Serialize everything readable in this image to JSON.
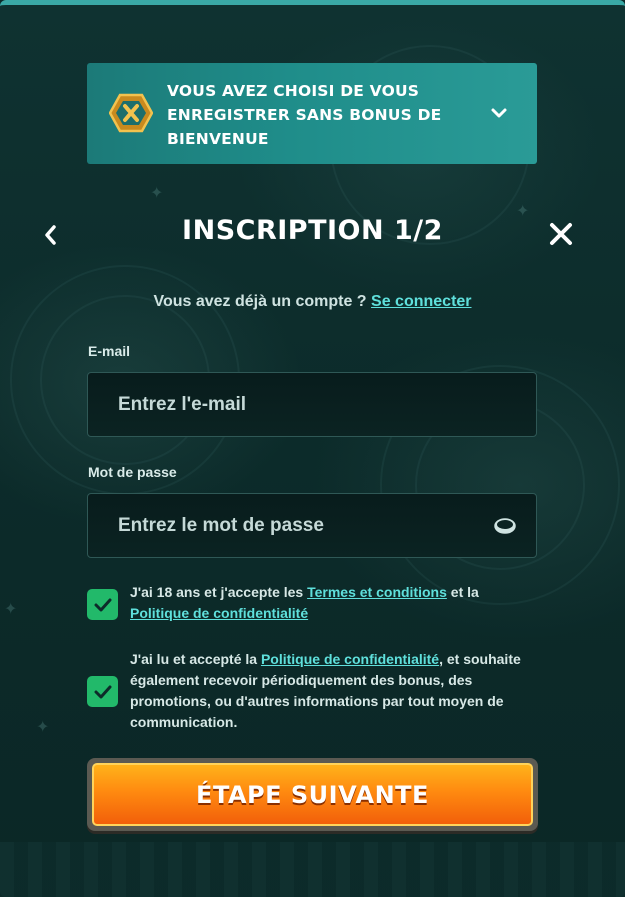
{
  "banner": {
    "text_line1": "VOUS AVEZ CHOISI DE VOUS",
    "text_line2": "ENREGISTRER SANS BONUS DE",
    "text_line3": "BIENVENUE"
  },
  "header": {
    "title": "INSCRIPTION 1/2"
  },
  "login": {
    "prompt": "Vous avez déjà un compte ?",
    "link": "Se connecter"
  },
  "email": {
    "label": "E-mail",
    "placeholder": "Entrez l'e-mail",
    "value": ""
  },
  "password": {
    "label": "Mot de passe",
    "placeholder": "Entrez le mot de passe",
    "value": ""
  },
  "consent1": {
    "checked": true,
    "text_before": "J'ai 18 ans et j'accepte les ",
    "link1": "Termes et conditions",
    "text_middle": " et la",
    "link2": "Politique de confidentialité"
  },
  "consent2": {
    "checked": true,
    "text_before": "J'ai lu et accepté la ",
    "link": "Politique de confidentialité",
    "text_after": ", et souhaite",
    "line2": "également recevoir périodiquement des bonus, des",
    "line3": "promotions, ou d'autres informations par tout moyen de",
    "line4": "communication."
  },
  "next_button": {
    "label": "ÉTAPE SUIVANTE"
  },
  "colors": {
    "accent": "#5fe0dc",
    "checkbox": "#22b96a",
    "button": "#ff8a10"
  }
}
